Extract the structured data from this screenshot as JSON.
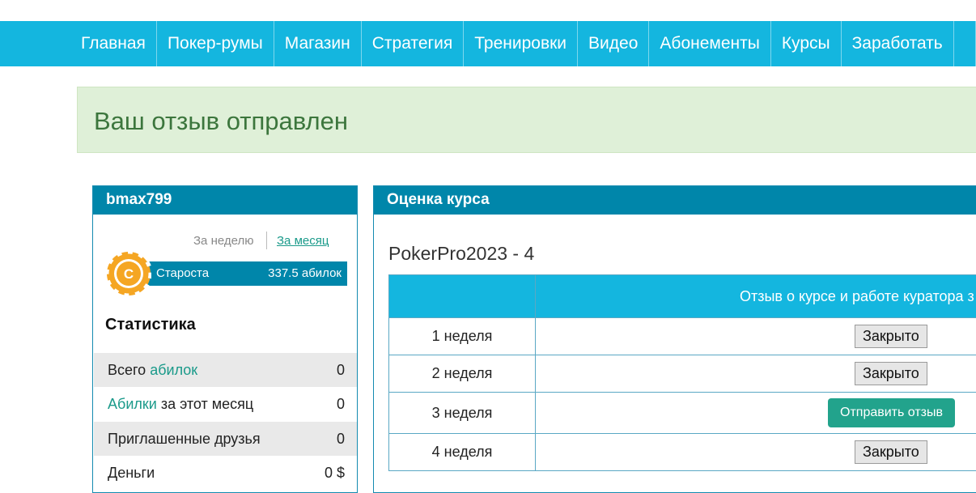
{
  "nav": {
    "items": [
      "Главная",
      "Покер-румы",
      "Магазин",
      "Стратегия",
      "Тренировки",
      "Видео",
      "Абонементы",
      "Курсы",
      "Заработать",
      ""
    ]
  },
  "alert": {
    "text": "Ваш отзыв отправлен"
  },
  "profile": {
    "username": "bmax799",
    "period_week": "За неделю",
    "period_month": "За месяц",
    "badge_letter": "C",
    "rank_name": "Староста",
    "rank_points": "337.5 абилок",
    "stats_title": "Статистика",
    "stats": [
      {
        "label_prefix": "Всего ",
        "label_link": "абилок",
        "label_suffix": "",
        "value": "0"
      },
      {
        "label_prefix": "",
        "label_link": "Абилки",
        "label_suffix": " за этот месяц",
        "value": "0"
      },
      {
        "label_prefix": "Приглашенные друзья",
        "label_link": "",
        "label_suffix": "",
        "value": "0"
      },
      {
        "label_prefix": "Деньги",
        "label_link": "",
        "label_suffix": "",
        "value": "0 $"
      }
    ]
  },
  "course": {
    "panel_title": "Оценка курса",
    "title": "PokerPro2023 - 4",
    "header_review": "Отзыв о курсе и работе куратора з",
    "rows": [
      {
        "week": "1 неделя",
        "action": "Закрыто"
      },
      {
        "week": "2 неделя",
        "action": "Закрыто"
      },
      {
        "week": "3 неделя",
        "action": "Отправить отзыв"
      },
      {
        "week": "4 неделя",
        "action": "Закрыто"
      }
    ]
  },
  "colors": {
    "nav_bg": "#14b6df",
    "panel_head": "#0086aa",
    "alert_bg": "#dff0d8",
    "accent": "#1a9a8a"
  }
}
